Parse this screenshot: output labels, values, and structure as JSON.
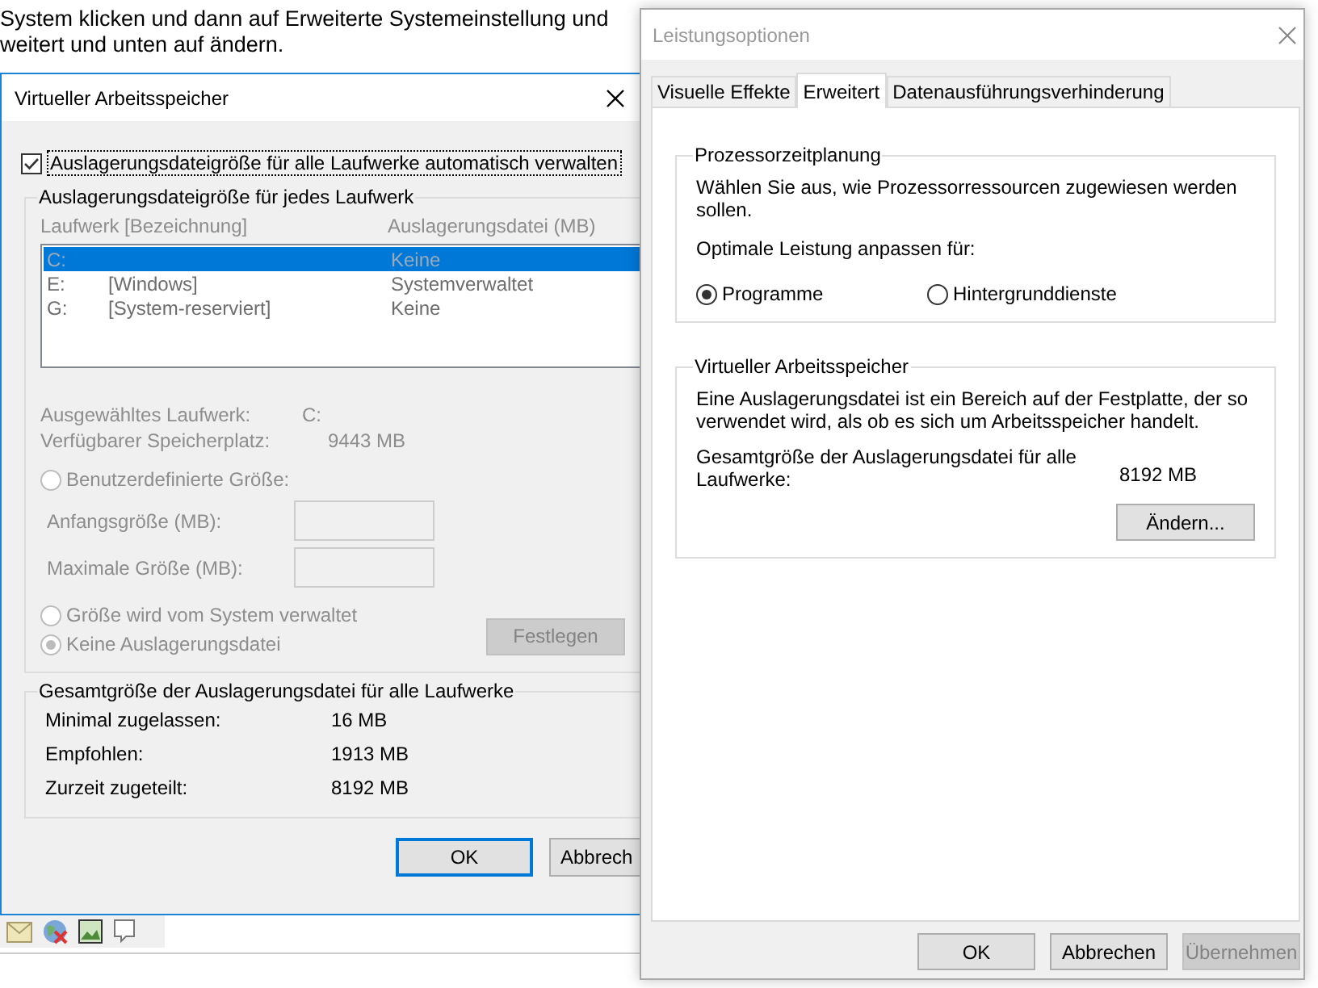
{
  "background_page": {
    "lines": [
      "System klicken und dann auf Erweiterte Systemeinstellung und",
      "weitert und unten auf ändern."
    ]
  },
  "memory_dialog": {
    "title": "Virtueller Arbeitsspeicher",
    "auto_manage": {
      "label": "Auslagerungsdateigröße für alle Laufwerke automatisch verwalten",
      "checked": true
    },
    "drives_group": {
      "title": "Auslagerungsdateigröße für jedes Laufwerk",
      "columns": [
        "Laufwerk [Bezeichnung]",
        "Auslagerungsdatei (MB)"
      ],
      "rows": [
        {
          "drive": "C:",
          "label": "",
          "paging_file": "Keine",
          "selected": true
        },
        {
          "drive": "E:",
          "label": "[Windows]",
          "paging_file": "Systemverwaltet",
          "selected": false
        },
        {
          "drive": "G:",
          "label": "[System-reserviert]",
          "paging_file": "Keine",
          "selected": false
        }
      ],
      "info": [
        {
          "label": "Ausgewähltes Laufwerk:",
          "value": "C:"
        },
        {
          "label": "Verfügbarer Speicherplatz:",
          "value": "9443 MB"
        }
      ],
      "custom_size": {
        "label": "Benutzerdefinierte Größe:",
        "selected": false
      },
      "size_fields": [
        {
          "label": "Anfangsgröße (MB):"
        },
        {
          "label": "Maximale Größe (MB):"
        }
      ],
      "system_managed": {
        "label": "Größe wird vom System verwaltet",
        "selected": false
      },
      "no_paging_file": {
        "label": "Keine Auslagerungsdatei",
        "selected": true
      },
      "set_button": "Festlegen"
    },
    "totals_group": {
      "title": "Gesamtgröße der Auslagerungsdatei für alle Laufwerke",
      "rows": [
        {
          "label": "Minimal zugelassen:",
          "value": "16 MB"
        },
        {
          "label": "Empfohlen:",
          "value": "1913 MB"
        },
        {
          "label": "Zurzeit zugeteilt:",
          "value": "8192 MB"
        }
      ]
    },
    "buttons": [
      {
        "label": "OK",
        "focused": true
      },
      {
        "label": "Abbrech",
        "focused": false
      }
    ]
  },
  "performance_window": {
    "title": "Leistungsoptionen",
    "tabs": [
      {
        "label": "Visuelle Effekte",
        "selected": false
      },
      {
        "label": "Erweitert",
        "selected": true
      },
      {
        "label": "Datenausführungsverhinderung",
        "selected": false
      }
    ],
    "scheduling_group": {
      "title": "Prozessorzeitplanung",
      "description": "Wählen Sie aus, wie Prozessorressourcen zugewiesen werden sollen.",
      "prompt": "Optimale Leistung anpassen für:",
      "options": [
        {
          "label": "Programme",
          "selected": true
        },
        {
          "label": "Hintergrunddienste",
          "selected": false
        }
      ]
    },
    "memory_group": {
      "title": "Virtueller Arbeitsspeicher",
      "description": "Eine Auslagerungsdatei ist ein Bereich auf der Festplatte, der so verwendet wird, als ob es sich um Arbeitsspeicher handelt.",
      "total_label": "Gesamtgröße der Auslagerungsdatei für alle Laufwerke:",
      "total_value": "8192 MB",
      "change_button": "Ändern..."
    },
    "buttons": [
      {
        "label": "OK",
        "disabled": false
      },
      {
        "label": "Abbrechen",
        "disabled": false
      },
      {
        "label": "Übernehmen",
        "disabled": true
      }
    ]
  }
}
